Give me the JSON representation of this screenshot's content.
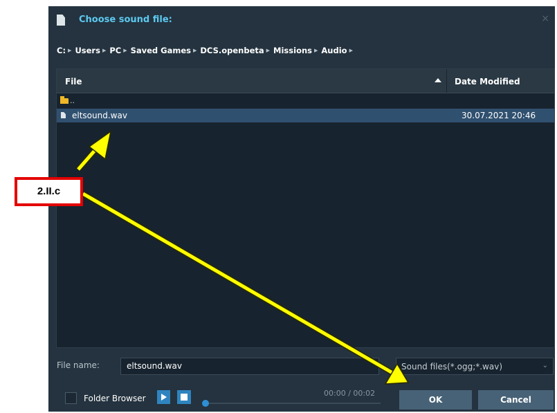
{
  "dialog": {
    "title": "Choose sound file:",
    "close_glyph": "×"
  },
  "breadcrumb": [
    {
      "label": "C:"
    },
    {
      "label": "Users"
    },
    {
      "label": "PC"
    },
    {
      "label": "Saved Games"
    },
    {
      "label": "DCS.openbeta"
    },
    {
      "label": "Missions"
    },
    {
      "label": "Audio"
    }
  ],
  "file_list": {
    "columns": {
      "file": "File",
      "date_modified": "Date Modified"
    },
    "sort": "ascending",
    "parent_row": {
      "label": ".."
    },
    "rows": [
      {
        "name": "eltsound.wav",
        "date": "30.07.2021 20:46",
        "selected": true
      }
    ]
  },
  "footer": {
    "file_name_label": "File name:",
    "file_name_value": "eltsound.wav",
    "filter_value": "Sound files(*.ogg;*.wav)",
    "folder_browser_label": "Folder Browser",
    "folder_browser_checked": false,
    "time": "00:00 / 00:02",
    "playback_position": 0,
    "ok_label": "OK",
    "cancel_label": "Cancel"
  },
  "annotation": {
    "label": "2.II.c",
    "box_color": "#e40000",
    "arrow_color": "#ffff00"
  },
  "colors": {
    "dialog_bg": "#24333f",
    "title_accent": "#5dc9f0",
    "selection": "#30506f",
    "button": "#476276",
    "media_button": "#2f84bf"
  },
  "icons": [
    "document-icon",
    "close-icon",
    "folder-icon",
    "file-icon",
    "sort-ascending-icon",
    "play-icon",
    "stop-icon",
    "chevron-down-icon"
  ]
}
